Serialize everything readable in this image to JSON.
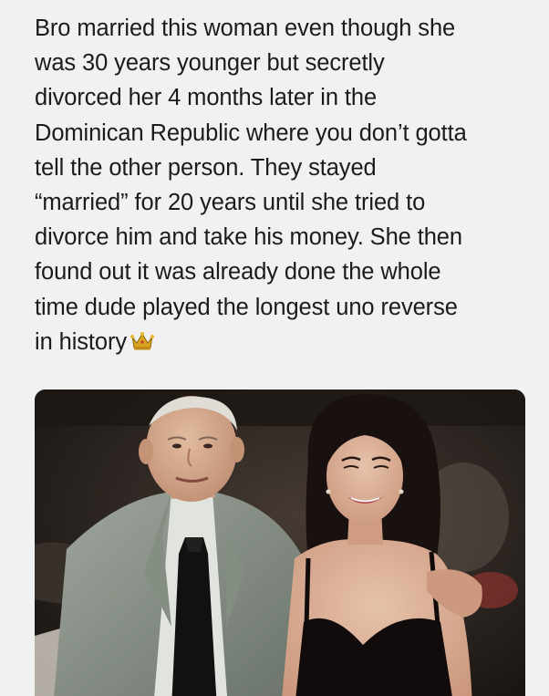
{
  "post": {
    "text_lines": [
      "Bro married this woman even though she",
      "was 30 years younger but secretly",
      "divorced her 4 months later in the",
      "Dominican Republic where you don’t gotta",
      "tell the other person.  They stayed",
      "“married” for 20 years until she tried to",
      "divorce him and take his money.  She then",
      "found out it was already done the whole",
      "time dude played the longest uno reverse",
      "in history"
    ],
    "emoji": "crown-icon"
  },
  "photo": {
    "subject": "older-man-and-younger-woman-photo"
  },
  "colors": {
    "background": "#f1f1f1",
    "text": "#1b1b1b"
  }
}
